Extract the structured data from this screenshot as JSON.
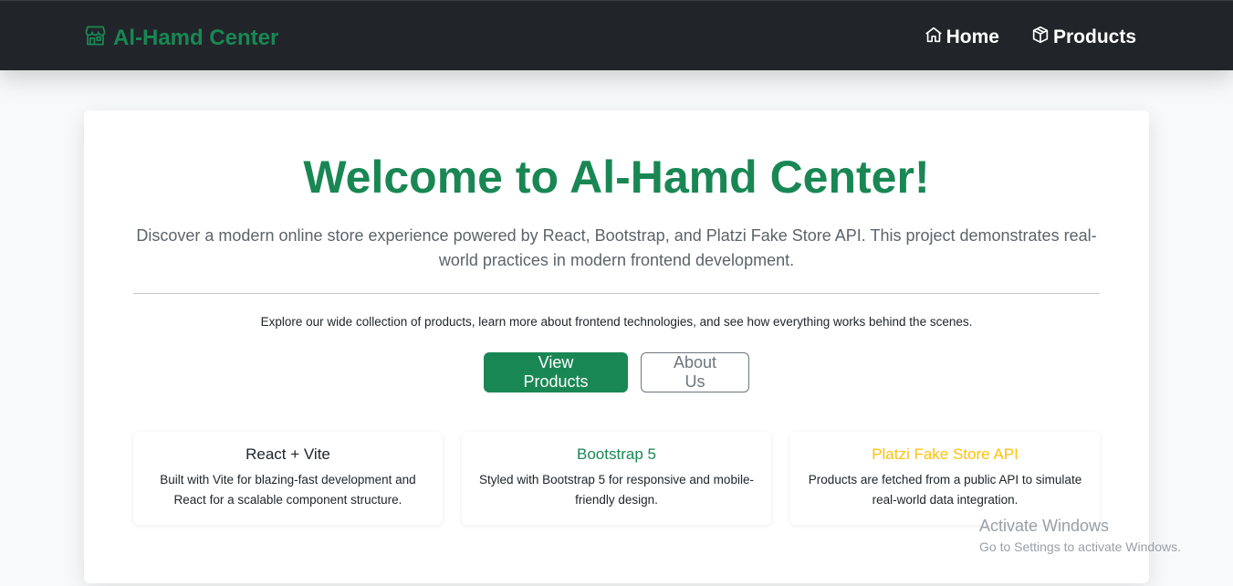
{
  "navbar": {
    "brand": "Al-Hamd Center",
    "links": [
      {
        "label": "Home",
        "icon": "home-icon"
      },
      {
        "label": "Products",
        "icon": "box-icon"
      }
    ]
  },
  "hero": {
    "title": "Welcome to Al-Hamd Center!",
    "lead": "Discover a modern online store experience powered by React, Bootstrap, and Platzi Fake Store API. This project demonstrates real-world practices in modern frontend development.",
    "explore": "Explore our wide collection of products, learn more about frontend technologies, and see how everything works behind the scenes.",
    "primary_button": "View Products",
    "secondary_button": "About Us"
  },
  "features": [
    {
      "title": "React + Vite",
      "text": "Built with Vite for blazing-fast development and React for a scalable component structure.",
      "color": "#212529"
    },
    {
      "title": "Bootstrap 5",
      "text": "Styled with Bootstrap 5 for responsive and mobile-friendly design.",
      "color": "#198754"
    },
    {
      "title": "Platzi Fake Store API",
      "text": "Products are fetched from a public API to simulate real-world data integration.",
      "color": "#ffc107"
    }
  ],
  "watermark": {
    "title": "Activate Windows",
    "subtitle": "Go to Settings to activate Windows."
  },
  "colors": {
    "brand": "#198754",
    "navbar_bg": "#212529",
    "accent_yellow": "#ffc107"
  }
}
